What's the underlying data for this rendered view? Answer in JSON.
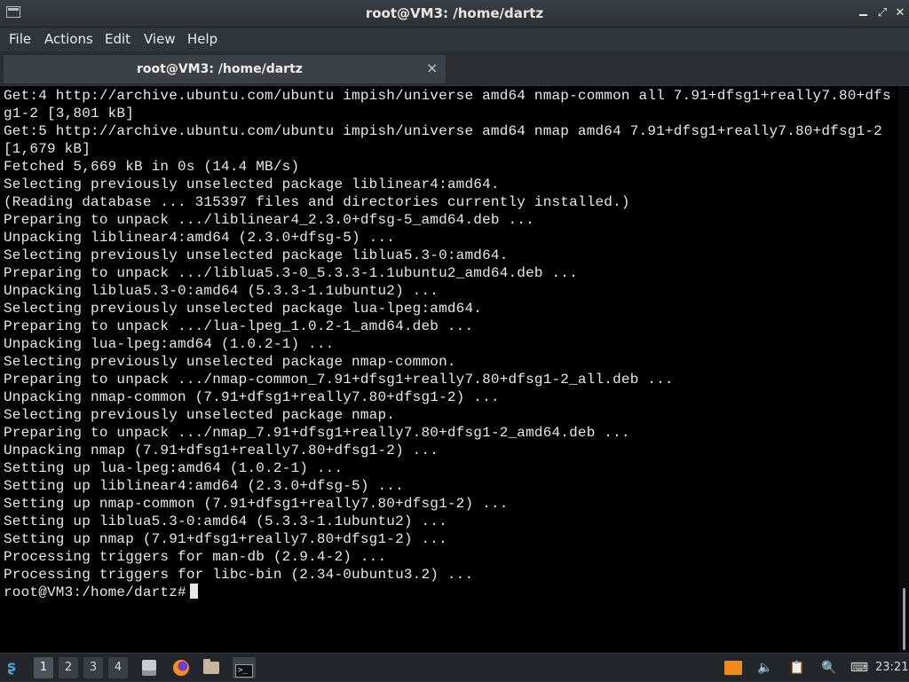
{
  "window": {
    "title": "root@VM3: /home/dartz",
    "controls": {
      "minimize": "_",
      "maximize": "⤢",
      "close": "✕"
    }
  },
  "menu": {
    "file": "File",
    "actions": "Actions",
    "edit": "Edit",
    "view": "View",
    "help": "Help"
  },
  "tab": {
    "title": "root@VM3: /home/dartz",
    "close": "×"
  },
  "terminal": {
    "lines": [
      "Get:4 http://archive.ubuntu.com/ubuntu impish/universe amd64 nmap-common all 7.91+dfsg1+really7.80+dfsg1-2 [3,801 kB]",
      "Get:5 http://archive.ubuntu.com/ubuntu impish/universe amd64 nmap amd64 7.91+dfsg1+really7.80+dfsg1-2 [1,679 kB]",
      "Fetched 5,669 kB in 0s (14.4 MB/s)",
      "Selecting previously unselected package liblinear4:amd64.",
      "(Reading database ... 315397 files and directories currently installed.)",
      "Preparing to unpack .../liblinear4_2.3.0+dfsg-5_amd64.deb ...",
      "Unpacking liblinear4:amd64 (2.3.0+dfsg-5) ...",
      "Selecting previously unselected package liblua5.3-0:amd64.",
      "Preparing to unpack .../liblua5.3-0_5.3.3-1.1ubuntu2_amd64.deb ...",
      "Unpacking liblua5.3-0:amd64 (5.3.3-1.1ubuntu2) ...",
      "Selecting previously unselected package lua-lpeg:amd64.",
      "Preparing to unpack .../lua-lpeg_1.0.2-1_amd64.deb ...",
      "Unpacking lua-lpeg:amd64 (1.0.2-1) ...",
      "Selecting previously unselected package nmap-common.",
      "Preparing to unpack .../nmap-common_7.91+dfsg1+really7.80+dfsg1-2_all.deb ...",
      "Unpacking nmap-common (7.91+dfsg1+really7.80+dfsg1-2) ...",
      "Selecting previously unselected package nmap.",
      "Preparing to unpack .../nmap_7.91+dfsg1+really7.80+dfsg1-2_amd64.deb ...",
      "Unpacking nmap (7.91+dfsg1+really7.80+dfsg1-2) ...",
      "Setting up lua-lpeg:amd64 (1.0.2-1) ...",
      "Setting up liblinear4:amd64 (2.3.0+dfsg-5) ...",
      "Setting up nmap-common (7.91+dfsg1+really7.80+dfsg1-2) ...",
      "Setting up liblua5.3-0:amd64 (5.3.3-1.1ubuntu2) ...",
      "Setting up nmap (7.91+dfsg1+really7.80+dfsg1-2) ...",
      "Processing triggers for man-db (2.9.4-2) ...",
      "Processing triggers for libc-bin (2.34-0ubuntu3.2) ..."
    ],
    "prompt": "root@VM3:/home/dartz#"
  },
  "taskbar": {
    "workspaces": [
      "1",
      "2",
      "3",
      "4"
    ],
    "active_workspace": "1",
    "launchers": [
      {
        "name": "files-icon"
      },
      {
        "name": "firefox-icon"
      },
      {
        "name": "folder-icon"
      },
      {
        "name": "terminal-icon"
      }
    ],
    "clock": "23:21"
  },
  "colors": {
    "terminal_bg": "#000000",
    "terminal_fg": "#e8e8e8",
    "window_chrome": "#31363b",
    "taskbar_bg": "#23272b",
    "update_tray": "#ee8c1a"
  }
}
